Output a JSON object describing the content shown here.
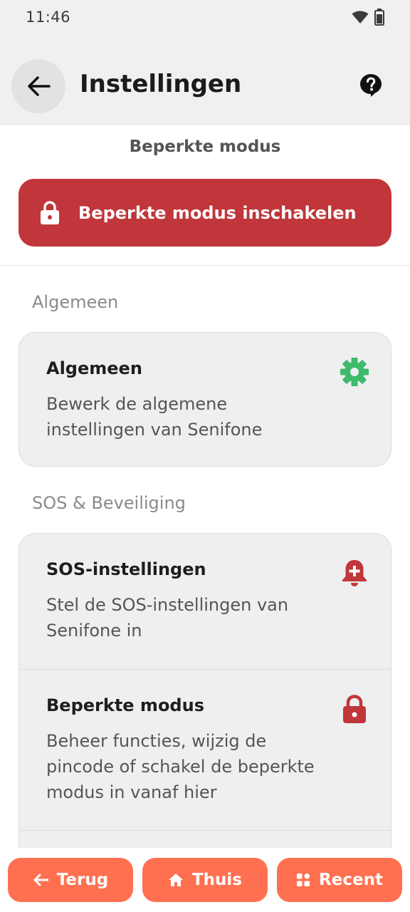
{
  "status": {
    "time": "11:46"
  },
  "header": {
    "title": "Instellingen"
  },
  "restricted_mode": {
    "heading": "Beperkte modus",
    "button_label": "Beperkte modus inschakelen"
  },
  "sections": [
    {
      "label": "Algemeen",
      "items": [
        {
          "title": "Algemeen",
          "description": "Bewerk de algemene instellingen van Senifone",
          "icon": "gear-icon",
          "icon_color": "#3dba6c"
        }
      ]
    },
    {
      "label": "SOS & Beveiliging",
      "items": [
        {
          "title": "SOS-instellingen",
          "description": "Stel de SOS-instellingen van Senifone in",
          "icon": "bell-plus-icon",
          "icon_color": "#c0363a"
        },
        {
          "title": "Beperkte modus",
          "description": "Beheer functies, wijzig de pincode of schakel de beperkte modus in vanaf hier",
          "icon": "lock-icon",
          "icon_color": "#c0363a"
        }
      ]
    }
  ],
  "navigation": {
    "back": "Terug",
    "home": "Thuis",
    "recent": "Recent"
  },
  "colors": {
    "accent_red": "#c0363a",
    "nav_orange": "#ff7050",
    "gear_green": "#3dba6c"
  }
}
